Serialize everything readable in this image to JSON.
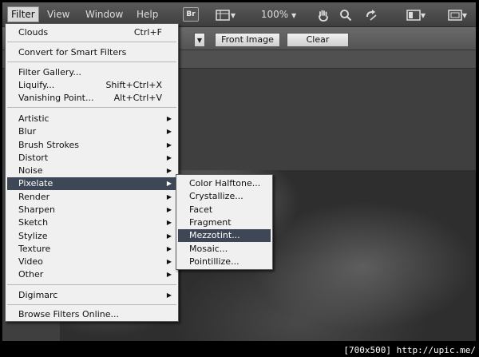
{
  "menubar": {
    "menus": [
      "Filter",
      "View",
      "Window",
      "Help"
    ],
    "bridge_label": "Br",
    "zoom": "100%"
  },
  "options": {
    "front_image": "Front Image",
    "clear": "Clear"
  },
  "filter_menu": {
    "items": [
      {
        "label": "Clouds",
        "shortcut": "Ctrl+F"
      },
      {
        "label": "Convert for Smart Filters"
      },
      {
        "label": "Filter Gallery..."
      },
      {
        "label": "Liquify...",
        "shortcut": "Shift+Ctrl+X"
      },
      {
        "label": "Vanishing Point...",
        "shortcut": "Alt+Ctrl+V"
      },
      {
        "label": "Artistic"
      },
      {
        "label": "Blur"
      },
      {
        "label": "Brush Strokes"
      },
      {
        "label": "Distort"
      },
      {
        "label": "Noise"
      },
      {
        "label": "Pixelate"
      },
      {
        "label": "Render"
      },
      {
        "label": "Sharpen"
      },
      {
        "label": "Sketch"
      },
      {
        "label": "Stylize"
      },
      {
        "label": "Texture"
      },
      {
        "label": "Video"
      },
      {
        "label": "Other"
      },
      {
        "label": "Digimarc"
      },
      {
        "label": "Browse Filters Online..."
      }
    ]
  },
  "pixelate_menu": {
    "items": [
      {
        "label": "Color Halftone..."
      },
      {
        "label": "Crystallize..."
      },
      {
        "label": "Facet"
      },
      {
        "label": "Fragment"
      },
      {
        "label": "Mezzotint..."
      },
      {
        "label": "Mosaic..."
      },
      {
        "label": "Pointillize..."
      }
    ]
  },
  "footer": "[700x500] http://upic.me/",
  "colors": {
    "highlight": "#3e4756",
    "menu_bg": "#f0f0f0"
  }
}
